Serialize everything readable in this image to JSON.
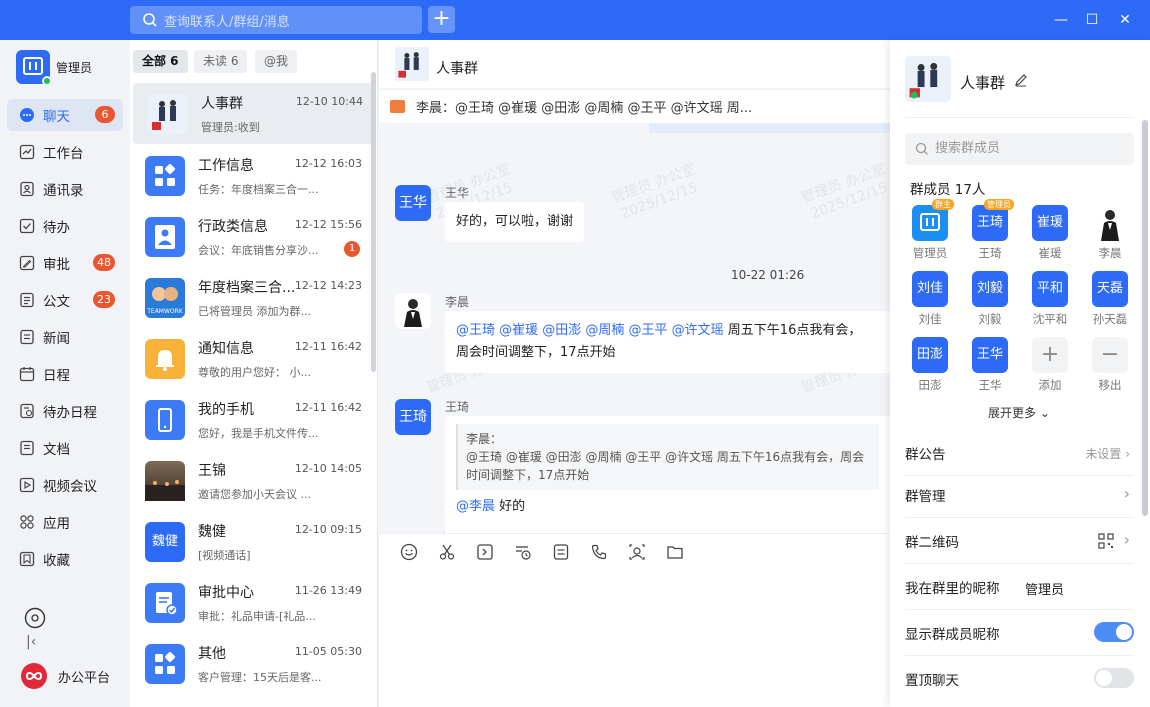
{
  "titlebar": {
    "search_placeholder": "查询联系人/群组/消息",
    "plus": "+"
  },
  "nav": {
    "user": "管理员",
    "items": [
      {
        "label": "聊天",
        "badge": "6"
      },
      {
        "label": "工作台",
        "badge": ""
      },
      {
        "label": "通讯录",
        "badge": ""
      },
      {
        "label": "待办",
        "badge": ""
      },
      {
        "label": "审批",
        "badge": "48"
      },
      {
        "label": "公文",
        "badge": "23"
      },
      {
        "label": "新闻",
        "badge": ""
      },
      {
        "label": "日程",
        "badge": ""
      },
      {
        "label": "待办日程",
        "badge": ""
      },
      {
        "label": "文档",
        "badge": ""
      },
      {
        "label": "视频会议",
        "badge": ""
      },
      {
        "label": "应用",
        "badge": ""
      },
      {
        "label": "收藏",
        "badge": ""
      }
    ],
    "platform": "办公平台"
  },
  "convlist": {
    "filters": [
      "全部 6",
      "未读 6",
      "@我"
    ],
    "items": [
      {
        "name": "人事群",
        "time": "12-10 10:44",
        "preview": "管理员:收到",
        "unread": ""
      },
      {
        "name": "工作信息",
        "time": "12-12 16:03",
        "preview": "任务：年度档案三合一...",
        "unread": ""
      },
      {
        "name": "行政类信息",
        "time": "12-12 15:56",
        "preview": "会议：年底销售分享沙...",
        "unread": "1"
      },
      {
        "name": "年度档案三合...",
        "time": "12-12 14:23",
        "preview": "已将管理员 添加为群...",
        "unread": ""
      },
      {
        "name": "通知信息",
        "time": "12-11 16:42",
        "preview": "尊敬的用户您好：  小...",
        "unread": ""
      },
      {
        "name": "我的手机",
        "time": "12-11 16:42",
        "preview": "您好，我是手机文件传...",
        "unread": ""
      },
      {
        "name": "王锦",
        "time": "12-10 14:05",
        "preview": "邀请您参加小天会议 ...",
        "unread": ""
      },
      {
        "name": "魏健",
        "time": "12-10 09:15",
        "preview": "[视频通话]",
        "unread": ""
      },
      {
        "name": "审批中心",
        "time": "11-26 13:49",
        "preview": "审批：礼品申请-[礼品...",
        "unread": ""
      },
      {
        "name": "其他",
        "time": "11-05 05:30",
        "preview": "客户管理：15天后是客...",
        "unread": ""
      }
    ],
    "weijian_avatar": "魏健",
    "teamwork": "TEAMWORK"
  },
  "chat": {
    "title": "人事群",
    "pinned": "李晨：@王琦 @崔瑗 @田澎 @周楠 @王平 @许文瑶 周...",
    "watermark": "管理员 办公室",
    "watermark_date": "2025/12/15",
    "msg1": {
      "avatar": "王华",
      "sender": "王华",
      "text": "好的，可以啦，谢谢"
    },
    "timestamp": "10-22 01:26",
    "msg2": {
      "sender": "李晨",
      "mentions": "@王琦 @崔瑗 @田澎 @周楠 @王平 @许文瑶",
      "text1": " 周五下午16点我有会，",
      "text2": "周会时间调整下，17点开始"
    },
    "msg3": {
      "avatar": "王琦",
      "sender": "王琦",
      "quote1": "李晨：",
      "quote2": "@王琦 @崔瑗 @田澎 @周楠 @王平 @许文瑶 周五下午16点我有会，周会",
      "quote3": "时间调整下，17点开始",
      "mention": "@李晨",
      "text": " 好的"
    }
  },
  "panel": {
    "group_name": "人事群",
    "search_placeholder": "搜索群成员",
    "member_count": "群成员 17人",
    "members": [
      {
        "name": "管理员",
        "avatar": "",
        "tag": "群主"
      },
      {
        "name": "王琦",
        "avatar": "王琦",
        "tag": "管理员"
      },
      {
        "name": "崔瑗",
        "avatar": "崔瑗",
        "tag": ""
      },
      {
        "name": "李晨",
        "avatar": "",
        "tag": ""
      },
      {
        "name": "刘佳",
        "avatar": "刘佳",
        "tag": ""
      },
      {
        "name": "刘毅",
        "avatar": "刘毅",
        "tag": ""
      },
      {
        "name": "沈平和",
        "avatar": "平和",
        "tag": ""
      },
      {
        "name": "孙天磊",
        "avatar": "天磊",
        "tag": ""
      },
      {
        "name": "田澎",
        "avatar": "田澎",
        "tag": ""
      },
      {
        "name": "王华",
        "avatar": "王华",
        "tag": ""
      },
      {
        "name": "添加",
        "avatar": "+",
        "tag": ""
      },
      {
        "name": "移出",
        "avatar": "−",
        "tag": ""
      }
    ],
    "expand": "展开更多 ⌄",
    "rows": [
      {
        "label": "群公告",
        "value": "未设置 ›"
      },
      {
        "label": "群管理",
        "value": "›"
      },
      {
        "label": "群二维码",
        "value": "›"
      },
      {
        "label": "我在群里的昵称",
        "value": "管理员"
      },
      {
        "label": "显示群成员昵称",
        "value": ""
      },
      {
        "label": "置顶聊天",
        "value": ""
      }
    ],
    "toggles": {
      "show_nick": true,
      "pin_chat": false
    }
  },
  "colors": {
    "accent": "#2d6bf6",
    "badge": "#e9572f",
    "toggle_off": "#e1e4e8"
  }
}
